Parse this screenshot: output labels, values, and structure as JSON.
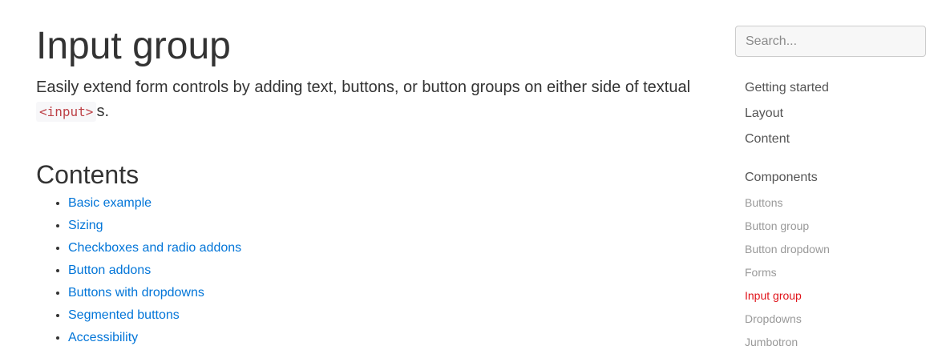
{
  "main": {
    "title": "Input group",
    "lead_text": "Easily extend form controls by adding text, buttons, or button groups on either side of textual",
    "lead_code": "<input>",
    "lead_suffix": "s.",
    "contents_heading": "Contents",
    "toc": [
      "Basic example",
      "Sizing",
      "Checkboxes and radio addons",
      "Button addons",
      "Buttons with dropdowns",
      "Segmented buttons",
      "Accessibility"
    ]
  },
  "sidebar": {
    "search_placeholder": "Search...",
    "sections": [
      "Getting started",
      "Layout",
      "Content",
      "Components"
    ],
    "component_items": [
      "Buttons",
      "Button group",
      "Button dropdown",
      "Forms",
      "Input group",
      "Dropdowns",
      "Jumbotron"
    ],
    "active_item": "Input group",
    "active_color": "#e0131a"
  },
  "colors": {
    "link": "#0275d8",
    "text": "#333333",
    "muted": "#999999",
    "code": "#bd4147"
  }
}
